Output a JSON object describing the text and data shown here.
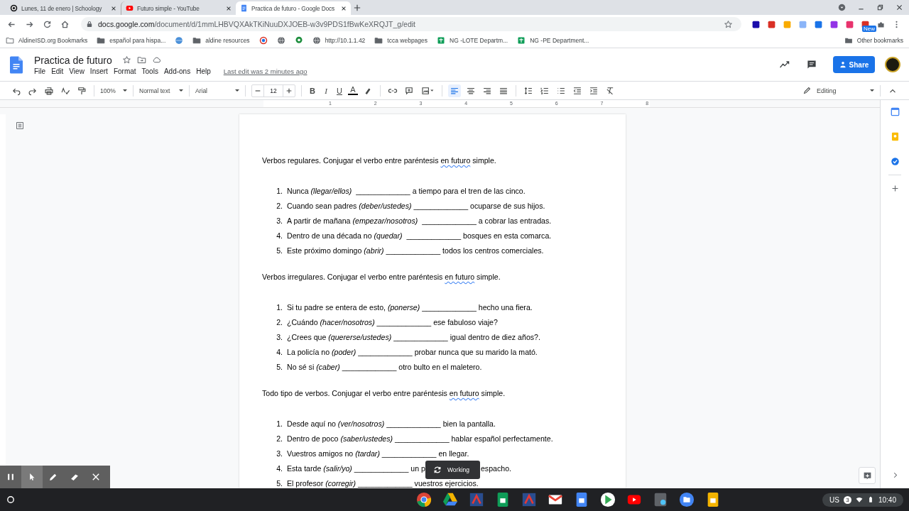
{
  "browser": {
    "tabs": [
      {
        "title": "Lunes, 11 de enero | Schoology",
        "kind": "schoology",
        "selected": false
      },
      {
        "title": "Futuro simple - YouTube",
        "kind": "youtube",
        "selected": false
      },
      {
        "title": "Practica de futuro - Google Docs",
        "kind": "docs",
        "selected": true
      }
    ],
    "url_host": "docs.google.com",
    "url_path": "/document/d/1mmLHBVQXAkTKiNuuDXJOEB-w3v9PDS1fBwKeXRQJT_g/edit",
    "bookmarks": [
      {
        "label": "AldineISD.org Bookmarks",
        "kind": "folder-plus"
      },
      {
        "label": "español para hispa...",
        "kind": "folder"
      },
      {
        "kind": "globe-blue"
      },
      {
        "label": "aldine resources",
        "kind": "folder"
      },
      {
        "kind": "swirl"
      },
      {
        "kind": "globe"
      },
      {
        "kind": "pin"
      },
      {
        "label": "http://10.1.1.42",
        "kind": "globe"
      },
      {
        "label": "tcca webpages",
        "kind": "folder"
      },
      {
        "label": "NG -LOTE Departm...",
        "kind": "sheet"
      },
      {
        "label": "NG -PE Department...",
        "kind": "sheet"
      }
    ],
    "other_bookmarks": "Other bookmarks",
    "new_badge": "New"
  },
  "doc": {
    "title": "Practica de futuro",
    "menus": [
      "File",
      "Edit",
      "View",
      "Insert",
      "Format",
      "Tools",
      "Add-ons",
      "Help"
    ],
    "last_edit": "Last edit was 2 minutes ago",
    "share": "Share",
    "toolbar": {
      "zoom": "100%",
      "style": "Normal text",
      "font": "Arial",
      "size": "12",
      "letters": [
        "B",
        "I",
        "U",
        "A"
      ],
      "alignment": [
        {
          "kind": "left",
          "selected": true
        },
        {
          "kind": "center",
          "selected": false
        },
        {
          "kind": "right",
          "selected": false
        },
        {
          "kind": "justify",
          "selected": false
        }
      ],
      "mode": "Editing"
    },
    "ruler": [
      "1",
      "2",
      "3",
      "4",
      "5",
      "6",
      "7",
      "8"
    ],
    "sections": [
      {
        "heading": "Verbos regulares. Conjugar el verbo entre paréntesis ",
        "marked": "en futuro",
        "heading_end": " simple.",
        "items": [
          {
            "number": "1.",
            "text": "Nunca *(llegar/ellos)*  _____________ a tiempo para el tren de las cinco."
          },
          {
            "number": "2.",
            "text": "Cuando sean padres *(deber/ustedes)* _____________ ocuparse de sus hijos."
          },
          {
            "number": "3.",
            "text": "A partir de mañana *(empezar/nosotros)*  _____________ a cobrar las entradas."
          },
          {
            "number": "4.",
            "text": "Dentro de una década no *(quedar)*  _____________ bosques en esta comarca."
          },
          {
            "number": "5.",
            "text": "Este próximo domingo *(abrir)* _____________ todos los centros comerciales."
          }
        ]
      },
      {
        "heading": "Verbos irregulares. Conjugar el verbo entre paréntesis ",
        "marked": "en futuro",
        "heading_end": " simple.",
        "items": [
          {
            "number": "1.",
            "text": "Si tu padre se entera de esto, *(ponerse)* _____________ hecho una fiera."
          },
          {
            "number": "2.",
            "text": "¿Cuándo *(hacer/nosotros)* _____________ ese fabuloso viaje?"
          },
          {
            "number": "3.",
            "text": "¿Crees que *(quererse/ustedes)* _____________ igual dentro de diez años?."
          },
          {
            "number": "4.",
            "text": "La policía no *(poder)* _____________ probar nunca que su marido la mató."
          },
          {
            "number": "5.",
            "text": "No sé si *(caber)* _____________ otro bulto en el maletero."
          }
        ]
      },
      {
        "heading": "Todo tipo de verbos. Conjugar el verbo entre paréntesis ",
        "marked": "en futuro",
        "heading_end": " simple.",
        "items": [
          {
            "number": "1.",
            "text": "Desde aquí no *(ver/nosotros)* _____________ bien la pantalla."
          },
          {
            "number": "2.",
            "text": "Dentro de poco *(saber/ustedes)* _____________ hablar español perfectamente."
          },
          {
            "number": "3.",
            "text": "Vuestros amigos no *(tardar)* _____________ en llegar."
          },
          {
            "number": "4.",
            "text": "Esta tarde *(salir/yo)* _____________ un p",
            "text_after": "espacho."
          },
          {
            "number": "5.",
            "text": "El profesor *(corregir)* _____________ vuestros ejercicios."
          }
        ]
      }
    ]
  },
  "toast": "Working",
  "shelf": {
    "locale": "US",
    "notifications": "3",
    "time": "10:40"
  }
}
